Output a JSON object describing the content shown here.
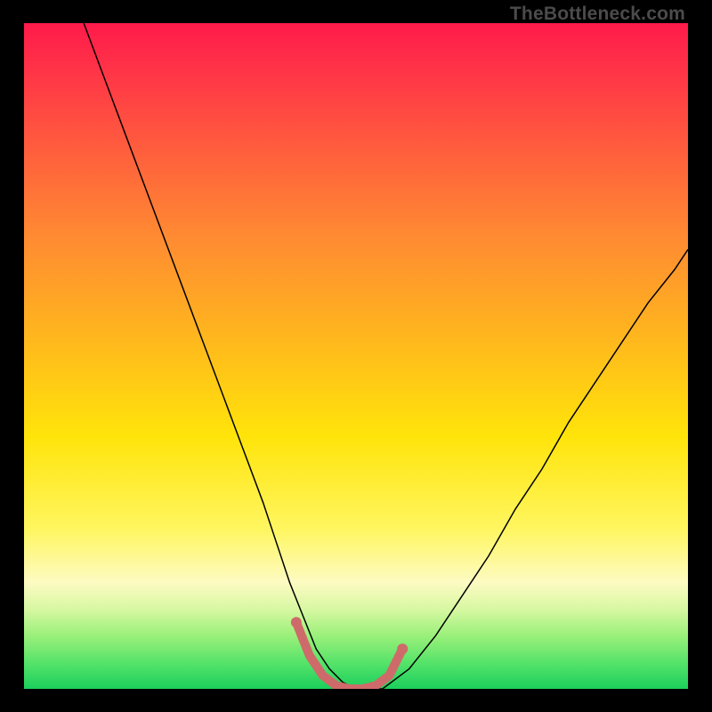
{
  "attribution": "TheBottleneck.com",
  "chart_data": {
    "type": "line",
    "title": "",
    "xlabel": "",
    "ylabel": "",
    "xlim": [
      0,
      100
    ],
    "ylim": [
      0,
      100
    ],
    "grid": false,
    "legend": false,
    "background_gradient": {
      "top": "#ff1a4a",
      "mid_upper": "#ff8a32",
      "mid": "#ffe40a",
      "mid_lower": "#fdfbc2",
      "bottom": "#1bd05c"
    },
    "series": [
      {
        "name": "bottleneck-curve",
        "stroke": "#000000",
        "stroke_width": 1.5,
        "x": [
          9,
          12,
          15,
          18,
          21,
          24,
          27,
          30,
          33,
          36,
          38,
          40,
          42,
          44,
          46,
          48,
          50,
          54,
          58,
          62,
          66,
          70,
          74,
          78,
          82,
          86,
          90,
          94,
          98,
          100
        ],
        "y": [
          100,
          92,
          84,
          76,
          68,
          60,
          52,
          44,
          36,
          28,
          22,
          16,
          11,
          6,
          3,
          1,
          0,
          0,
          3,
          8,
          14,
          20,
          27,
          33,
          40,
          46,
          52,
          58,
          63,
          66
        ]
      },
      {
        "name": "optimal-highlight",
        "stroke": "#cf6a6a",
        "stroke_width": 10,
        "linecap": "round",
        "x": [
          41,
          43,
          45,
          47,
          49,
          51,
          53,
          55,
          57
        ],
        "y": [
          10,
          5,
          2,
          0.5,
          0,
          0,
          0.5,
          2,
          6
        ]
      }
    ],
    "endpoint_markers": [
      {
        "x": 41,
        "y": 10,
        "r": 6,
        "fill": "#cf6a6a"
      },
      {
        "x": 57,
        "y": 6,
        "r": 6,
        "fill": "#cf6a6a"
      }
    ]
  }
}
